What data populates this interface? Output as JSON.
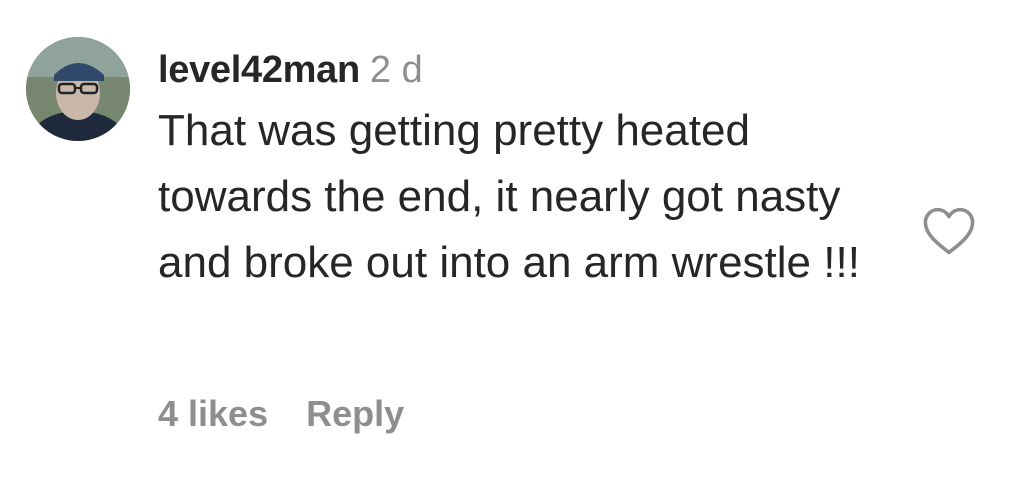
{
  "comment": {
    "username": "level42man",
    "time": "2 d",
    "text": "That was getting pretty heated towards the end, it nearly got nasty and broke out into an arm wrestle !!!",
    "likes": "4 likes",
    "reply_label": "Reply",
    "like_icon": "heart-outline-icon",
    "avatar": "avatar"
  },
  "colors": {
    "text": "#262626",
    "secondary": "#8e8e8e"
  }
}
